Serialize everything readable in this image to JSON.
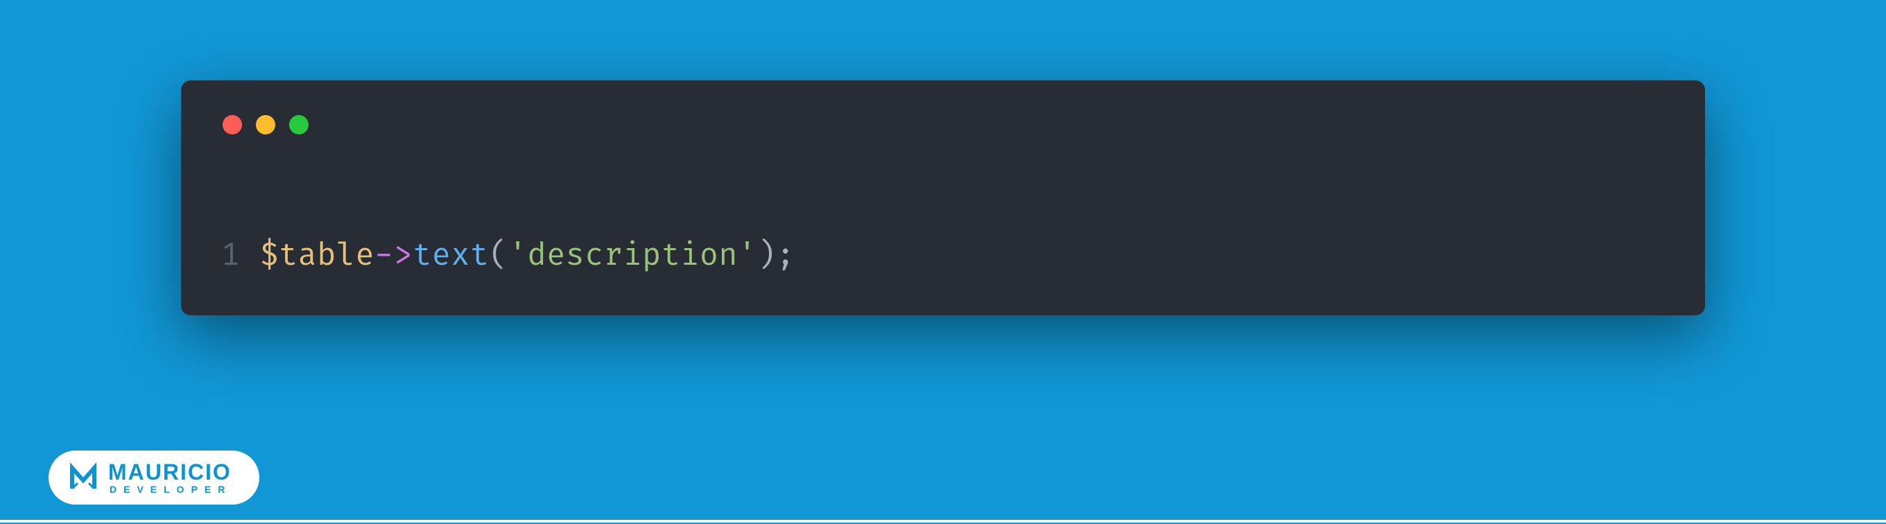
{
  "code": {
    "line_number": "1",
    "tokens": {
      "var": "$table",
      "arrow": "->",
      "func": "text",
      "open": "(",
      "string": "'description'",
      "close": ")",
      "semi": ";"
    }
  },
  "badge": {
    "main": "MAURICIO",
    "sub": "DEVELOPER"
  },
  "colors": {
    "background": "#1197d6",
    "editor_bg": "#282c34",
    "accent": "#0d93d1"
  }
}
